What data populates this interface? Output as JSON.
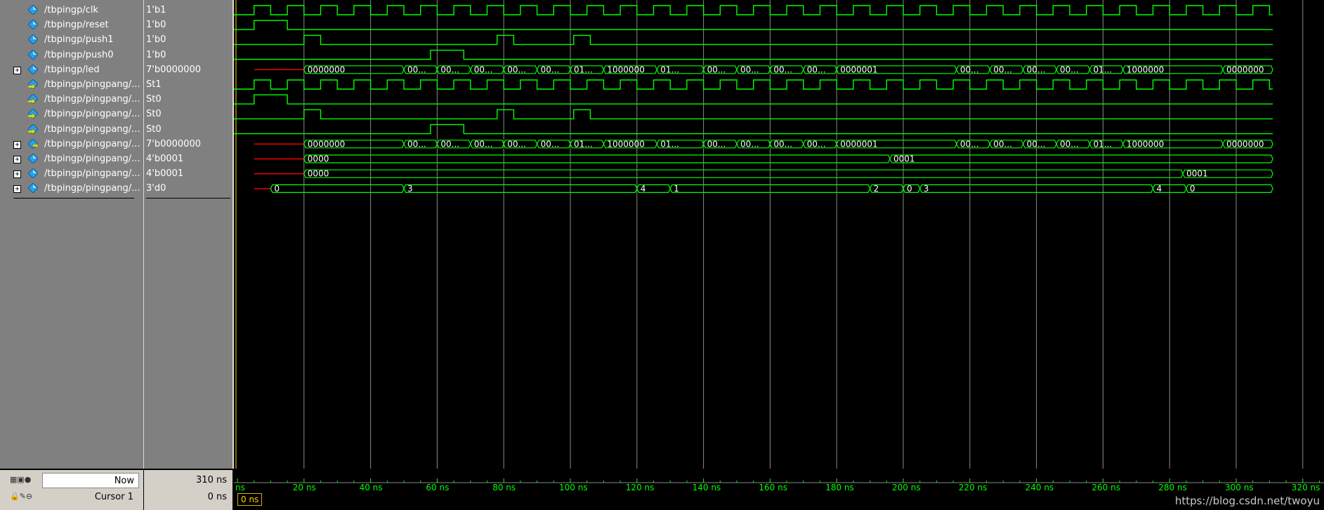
{
  "signals": [
    {
      "name": "/tbpingp/clk",
      "value": "1'b1",
      "icon": "signal-diamond-icon",
      "expandable": false
    },
    {
      "name": "/tbpingp/reset",
      "value": "1'b0",
      "icon": "signal-diamond-icon",
      "expandable": false
    },
    {
      "name": "/tbpingp/push1",
      "value": "1'b0",
      "icon": "signal-diamond-icon",
      "expandable": false
    },
    {
      "name": "/tbpingp/push0",
      "value": "1'b0",
      "icon": "signal-diamond-icon",
      "expandable": false
    },
    {
      "name": "/tbpingp/led",
      "value": "7'b0000000",
      "icon": "signal-diamond-icon",
      "expandable": true
    },
    {
      "name": "/tbpingp/pingpang/...",
      "value": "St1",
      "icon": "input-port-icon",
      "expandable": false
    },
    {
      "name": "/tbpingp/pingpang/...",
      "value": "St0",
      "icon": "input-port-icon",
      "expandable": false
    },
    {
      "name": "/tbpingp/pingpang/...",
      "value": "St0",
      "icon": "input-port-icon",
      "expandable": false
    },
    {
      "name": "/tbpingp/pingpang/...",
      "value": "St0",
      "icon": "input-port-icon",
      "expandable": false
    },
    {
      "name": "/tbpingp/pingpang/...",
      "value": "7'b0000000",
      "icon": "output-port-icon",
      "expandable": true
    },
    {
      "name": "/tbpingp/pingpang/...",
      "value": "4'b0001",
      "icon": "signal-diamond-icon",
      "expandable": true
    },
    {
      "name": "/tbpingp/pingpang/...",
      "value": "4'b0001",
      "icon": "signal-diamond-icon",
      "expandable": true
    },
    {
      "name": "/tbpingp/pingpang/...",
      "value": "3'd0",
      "icon": "signal-diamond-icon",
      "expandable": true
    }
  ],
  "waves": {
    "clk_period_ns": 10,
    "clk_first_rise_ns": 5,
    "reset_high": [
      [
        5,
        15
      ]
    ],
    "push1_high": [
      [
        20,
        25
      ],
      [
        78,
        83
      ],
      [
        101,
        106
      ]
    ],
    "push0_high": [
      [
        58,
        68
      ]
    ],
    "led_bus": [
      {
        "start": 2.5,
        "end": 10,
        "label": "",
        "color": "#ff0000"
      },
      {
        "start": 10,
        "end": 25,
        "label": "0000000"
      },
      {
        "start": 25,
        "end": 30,
        "label": "00..."
      },
      {
        "start": 30,
        "end": 35,
        "label": "00..."
      },
      {
        "start": 35,
        "end": 40,
        "label": "00..."
      },
      {
        "start": 40,
        "end": 45,
        "label": "00..."
      },
      {
        "start": 45,
        "end": 50,
        "label": "00..."
      },
      {
        "start": 50,
        "end": 55,
        "label": "01..."
      },
      {
        "start": 55,
        "end": 63,
        "label": "1000000"
      },
      {
        "start": 63,
        "end": 70,
        "label": "01..."
      },
      {
        "start": 70,
        "end": 75,
        "label": "00..."
      },
      {
        "start": 75,
        "end": 80,
        "label": "00..."
      },
      {
        "start": 80,
        "end": 85,
        "label": "00..."
      },
      {
        "start": 85,
        "end": 90,
        "label": "00..."
      },
      {
        "start": 90,
        "end": 108,
        "label": "0000001"
      },
      {
        "start": 108,
        "end": 113,
        "label": "00..."
      },
      {
        "start": 113,
        "end": 118,
        "label": "00..."
      },
      {
        "start": 118,
        "end": 123,
        "label": "00..."
      },
      {
        "start": 123,
        "end": 128,
        "label": "00..."
      },
      {
        "start": 128,
        "end": 133,
        "label": "01..."
      },
      {
        "start": 133,
        "end": 148,
        "label": "1000000"
      },
      {
        "start": 148,
        "end": 155.5,
        "label": "0000000"
      }
    ],
    "count1_bus": [
      {
        "start": 2.5,
        "end": 10,
        "label": "",
        "color": "#ff0000"
      },
      {
        "start": 10,
        "end": 98,
        "label": "0000"
      },
      {
        "start": 98,
        "end": 155.5,
        "label": "0001"
      }
    ],
    "count0_bus": [
      {
        "start": 2.5,
        "end": 10,
        "label": "",
        "color": "#ff0000"
      },
      {
        "start": 10,
        "end": 142,
        "label": "0000"
      },
      {
        "start": 142,
        "end": 155.5,
        "label": "0001"
      }
    ],
    "state_bus": [
      {
        "start": 2.5,
        "end": 5,
        "label": "",
        "color": "#ff0000"
      },
      {
        "start": 5,
        "end": 25,
        "label": "0"
      },
      {
        "start": 25,
        "end": 60,
        "label": "3"
      },
      {
        "start": 60,
        "end": 65,
        "label": "4"
      },
      {
        "start": 65,
        "end": 95,
        "label": "1"
      },
      {
        "start": 95,
        "end": 100,
        "label": "2"
      },
      {
        "start": 100,
        "end": 102.5,
        "label": "0"
      },
      {
        "start": 102.5,
        "end": 137.5,
        "label": "3"
      },
      {
        "start": 137.5,
        "end": 142.5,
        "label": "4"
      },
      {
        "start": 142.5,
        "end": 155.5,
        "label": "0"
      }
    ],
    "end_ns": 155.5,
    "gridline_every_ns": 20
  },
  "status": {
    "now_label": "Now",
    "now_value": "310 ns",
    "cursor_label": "Cursor 1",
    "cursor_value": "0 ns",
    "cursor_tag": "0 ns"
  },
  "timeline": {
    "ticks": [
      "ns",
      "20 ns",
      "40 ns",
      "60 ns",
      "80 ns",
      "100 ns",
      "120 ns",
      "140 ns",
      "160 ns",
      "180 ns",
      "200 ns",
      "220 ns",
      "240 ns",
      "260 ns",
      "280 ns",
      "300 ns",
      "320 ns"
    ]
  },
  "watermark": "https://blog.csdn.net/twoyu",
  "colors": {
    "wave": "#00ff00",
    "grid": "#8a8a8a",
    "undefined": "#ff0000",
    "tick_text": "#00ff00",
    "cursor": "#ffd000"
  }
}
